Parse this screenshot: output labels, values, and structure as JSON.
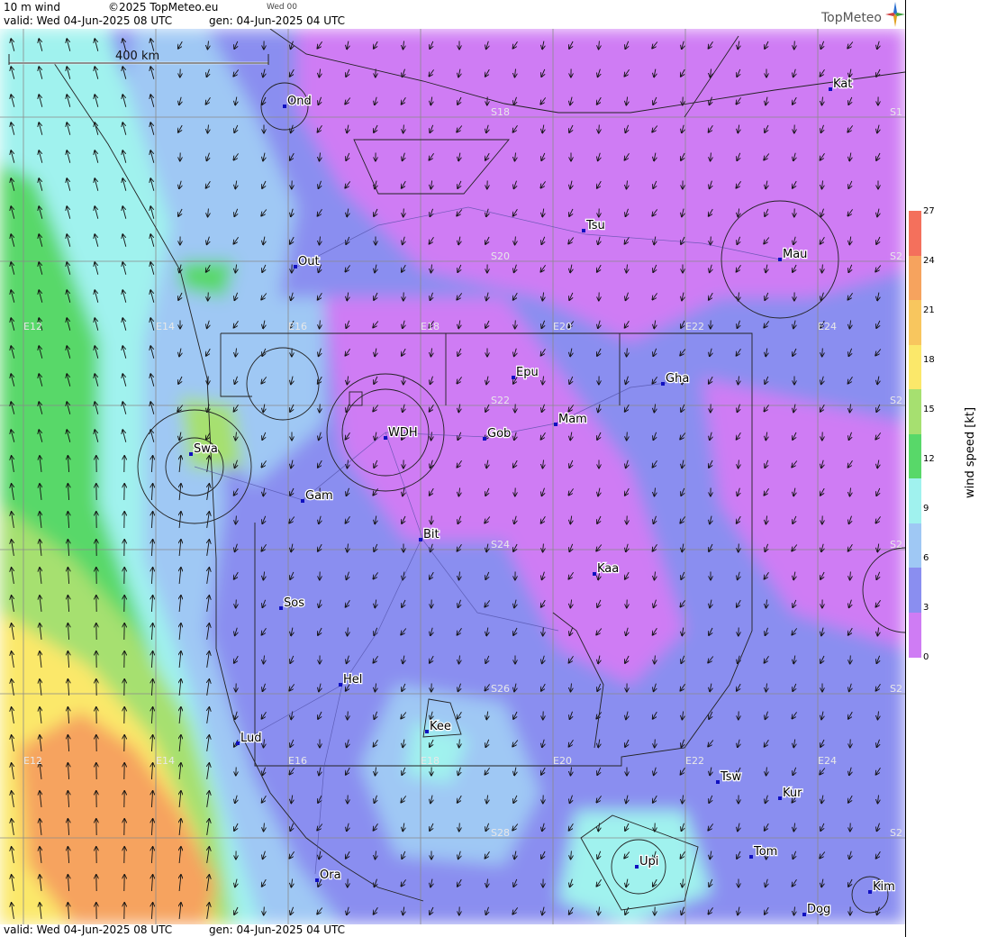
{
  "header": {
    "product": "10 m wind",
    "copyright": "©2025 TopMeteo.eu",
    "time_short": "Wed 00",
    "valid": "valid:  Wed  04-Jun-2025  08 UTC",
    "gen": "gen: 04-Jun-2025 04 UTC",
    "brand": "TopMeteo"
  },
  "footer": {
    "valid": "valid:  Wed  04-Jun-2025  08 UTC",
    "gen": "gen: 04-Jun-2025 04 UTC"
  },
  "scale_bar": {
    "label": "400 km"
  },
  "colorbar": {
    "title": "wind speed [kt]",
    "ticks": [
      "27",
      "24",
      "21",
      "18",
      "15",
      "12",
      "9",
      "6",
      "3",
      "0"
    ],
    "colors": [
      "#f4705c",
      "#f6a35e",
      "#f8c65e",
      "#fbe86a",
      "#a6e070",
      "#58d869",
      "#a0f2ee",
      "#9fc8f4",
      "#8a8ef0",
      "#cf7cf4"
    ]
  },
  "grid_labels": {
    "lat": [
      "S18",
      "S20",
      "S22",
      "S24",
      "S26",
      "S28"
    ],
    "lon": [
      "E12",
      "E14",
      "E16",
      "E18",
      "E20",
      "E22",
      "E24"
    ],
    "edge": [
      "S1",
      "S2",
      "S2",
      "S2",
      "S2",
      "S2",
      "S2"
    ]
  },
  "places": [
    {
      "name": "Ond"
    },
    {
      "name": "Kat"
    },
    {
      "name": "Tsu"
    },
    {
      "name": "Mau"
    },
    {
      "name": "Out"
    },
    {
      "name": "Epu"
    },
    {
      "name": "Gha"
    },
    {
      "name": "Mam"
    },
    {
      "name": "Gob"
    },
    {
      "name": "WDH"
    },
    {
      "name": "Swa"
    },
    {
      "name": "Gam"
    },
    {
      "name": "Bit"
    },
    {
      "name": "Kaa"
    },
    {
      "name": "Sos"
    },
    {
      "name": "Hel"
    },
    {
      "name": "Kee"
    },
    {
      "name": "Lud"
    },
    {
      "name": "Tsw"
    },
    {
      "name": "Kur"
    },
    {
      "name": "Tom"
    },
    {
      "name": "Ora"
    },
    {
      "name": "Upi"
    },
    {
      "name": "Kim"
    },
    {
      "name": "Dog"
    }
  ]
}
